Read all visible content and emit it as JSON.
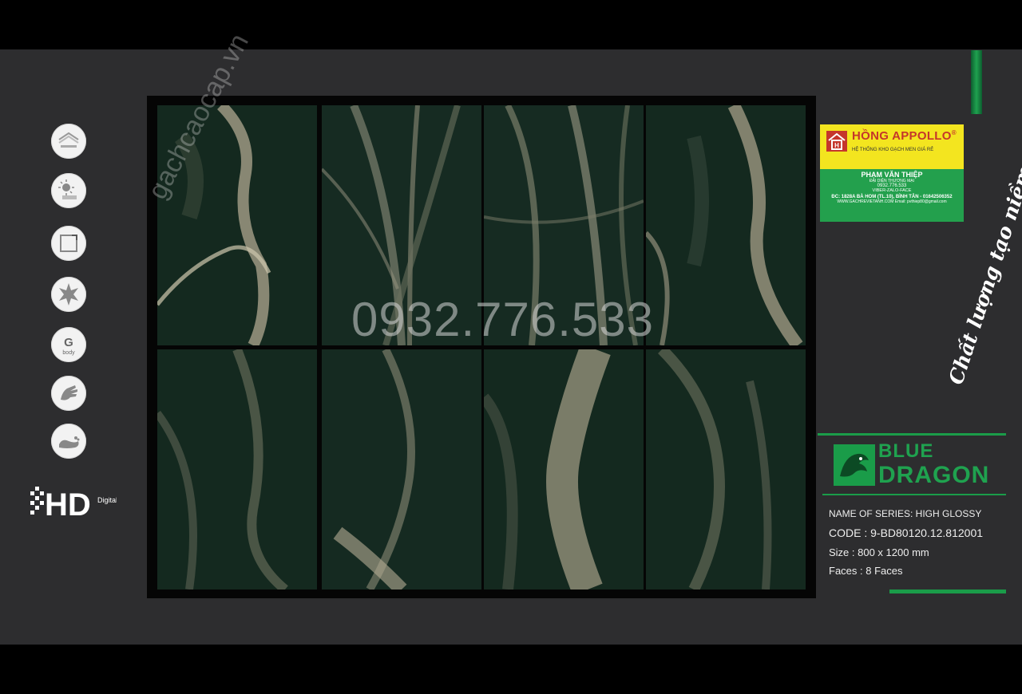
{
  "watermarks": {
    "site": "gachcaocap.vn",
    "phone": "0932.776.533"
  },
  "feature_icons": [
    {
      "icon": "roof-stack-icon"
    },
    {
      "icon": "sun-resistant-icon"
    },
    {
      "icon": "square-edge-icon"
    },
    {
      "icon": "starburst-icon"
    },
    {
      "icon": "g-body-icon",
      "label": "G",
      "sublabel": "body"
    },
    {
      "icon": "hand-touch-icon"
    },
    {
      "icon": "foot-icon"
    }
  ],
  "hd_badge": {
    "label": "HD",
    "sublabel": "Digital"
  },
  "dealer_card": {
    "brand": "HỒNG APPOLLO",
    "reg": "®",
    "tagline": "HỆ THỐNG KHO GẠCH MEN GIÁ RẺ",
    "name": "PHẠM VĂN THIỆP",
    "role": "ĐẠI DIỆN THƯƠNG MẠI",
    "phone": "0932.776.533",
    "contact": "VIBER-ZALO-FACE",
    "address": "ĐC: 1828A BÀ HOM (TL.10), BÌNH TÂN - 01642506352",
    "web": "WWW.GACHREVIETANH.COM  Email: pvthiep80@gmail.com"
  },
  "slogan": "Chất lượng tạo niềm tin",
  "brand": {
    "line1": "BLUE",
    "line2": "DRAGON"
  },
  "specs": {
    "series": "NAME OF SERIES:  HIGH GLOSSY",
    "code": "CODE  :  9-BD80120.12.812001",
    "size": "Size    :  800 x 1200 mm",
    "faces": "Faces  :  8 Faces"
  },
  "colors": {
    "panel": "#2d2d2f",
    "tile_base": "#13281f",
    "vein": "#a59f88",
    "accent_green": "#1fa24f",
    "card_yellow": "#f3e51f",
    "brand_red": "#c5362b"
  }
}
